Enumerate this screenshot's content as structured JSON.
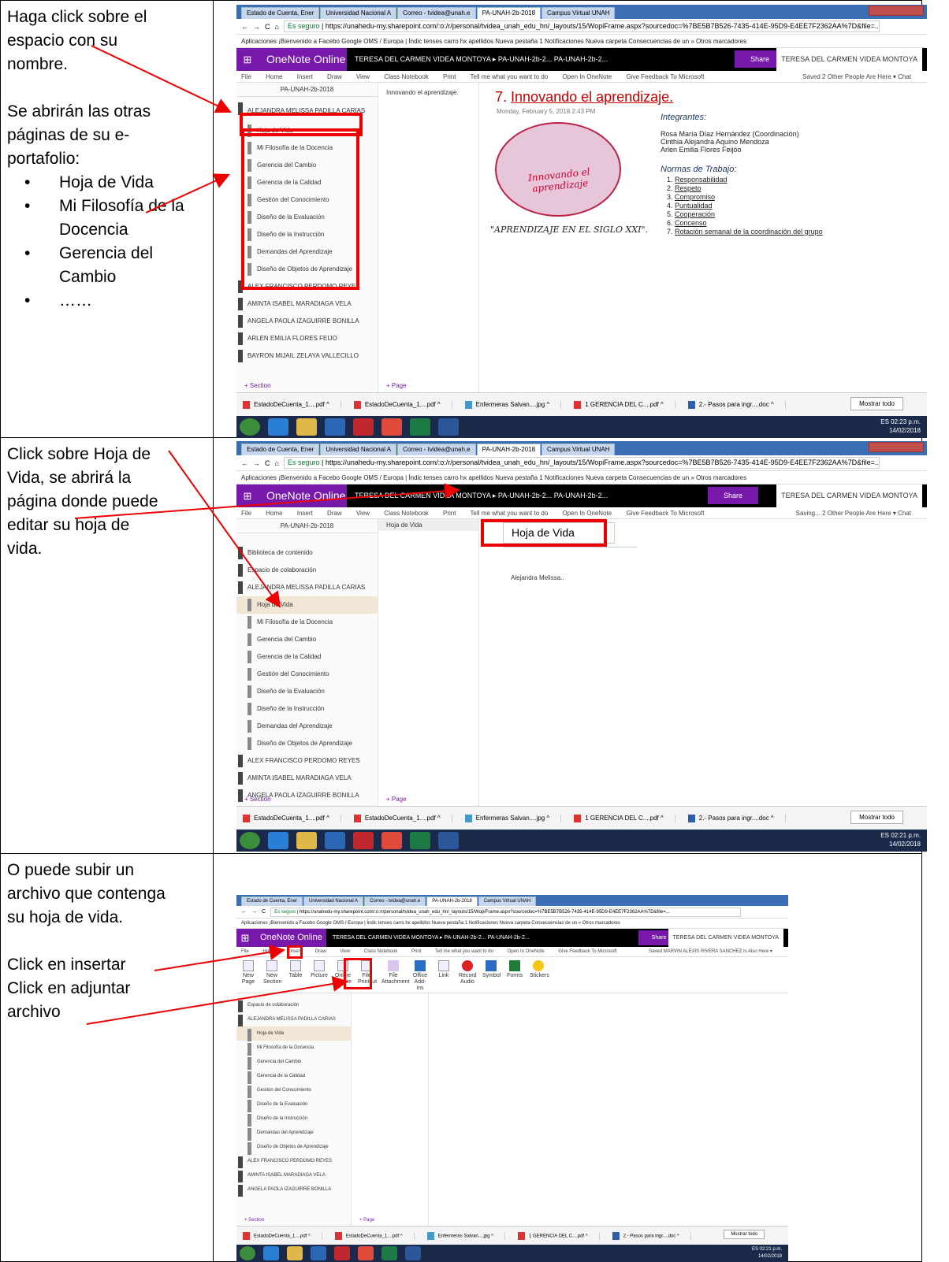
{
  "rows": [
    {
      "instruction_lines": [
        "Haga click sobre el",
        "espacio con su",
        "nombre."
      ],
      "instruction_lines2": [
        "Se abrirán las otras",
        "páginas de su e-",
        "portafolio:"
      ],
      "bullets": [
        "Hoja de Vida",
        "Mi Filosofía de la Docencia",
        "Gerencia del Cambio",
        "……"
      ]
    },
    {
      "instruction_lines": [
        "Click sobre Hoja de",
        "Vida, se abrirá la",
        "página donde puede",
        "editar su hoja de",
        "vida."
      ]
    },
    {
      "instruction_lines": [
        "O puede subir un",
        "archivo que contenga",
        "su hoja de vida."
      ],
      "instruction_lines2": [
        "Click en insertar",
        "Click en adjuntar",
        "archivo"
      ]
    }
  ],
  "browser": {
    "tabs": [
      "Estado de Cuenta, Ener",
      "Universidad Nacional A",
      "Correo - tvidea@unah.e",
      "PA-UNAH-2b-2018",
      "Campus Virtual UNAH"
    ],
    "secure": "Es seguro",
    "url": "https://unahedu-my.sharepoint.com/:o:/r/personal/tvidea_unah_edu_hn/_layouts/15/WopiFrame.aspx?sourcedoc=%7BE5B7B526-7435-414E-95D9-E4EE7F2362AA%7D&file=...",
    "bookmarks": "Aplicaciones   ¡Bienvenido a Facebo   Google   OMS / Europa | Índic   tenses   carro   hx apellidos   Nueva pestaña   1 Notificaciones   Nueva carpeta   Consecuencias de un   »   Otros marcadores"
  },
  "onenote": {
    "waffle": "⊞",
    "brand": "OneNote Online",
    "breadcrumb": "TERESA DEL CARMEN VIDEA MONTOYA  ▸  PA-UNAH-2b-2...          PA-UNAH-2b-2...",
    "share": "Share",
    "user": "TERESA DEL CARMEN VIDEA MONTOYA",
    "menu": [
      "File",
      "Home",
      "Insert",
      "Draw",
      "View",
      "Class Notebook",
      "Print",
      "Tell me what you want to do",
      "Open In OneNote",
      "Give Feedback To Microsoft"
    ],
    "status1": "Saved   2 Other People Are Here ▾   Chat",
    "status2": "Saving...   2 Other People Are Here ▾   Chat",
    "status3": "Saved   MARVIN ALEXIS RIVERA SANCHEZ Is Also Here ▾",
    "notebook": "PA-UNAH-2b-2018",
    "section_open": "ALEJANDRA MELISSA PADILLA CARIAS",
    "pages": [
      "Hoja de Vida",
      "Mi Filosofía de la Docencia",
      "Gerencia del Cambio",
      "Gerencia de la Calidad",
      "Gestión del Conocimiento",
      "Diseño de la Evaluación",
      "Diseño de la Instrucción",
      "Demandas del Aprendizaje",
      "Diseño de Objetos de Aprendizaje"
    ],
    "other_sections": [
      "ALEX FRANCISCO PERDOMO REYES",
      "AMINTA ISABEL MARADIAGA VELA",
      "ANGELA PAOLA IZAGUIRRE BONILLA",
      "ARLEN EMILIA FLORES FEIJO",
      "BAYRON MIJAIL ZELAYA VALLECILLO"
    ],
    "extra_sections": [
      "Biblioteca de contenido",
      "Espacio de colaboración"
    ],
    "add_section": "+ Section",
    "add_page": "+ Page",
    "page_list_item": "Innovando el aprendizaje.",
    "page2_list_item": "Hoja de Vida"
  },
  "page1": {
    "title_num": "7.",
    "title": "Innovando el aprendizaje.",
    "date": "Monday, February 5, 2018   2:43 PM",
    "logo_text": "Innovando el aprendizaje",
    "quote": "\"APRENDIZAJE EN EL SIGLO  XXI\".",
    "integrantes_h": "Integrantes:",
    "integrantes": [
      "Rosa María Díaz Hernández (Coordinación)",
      "Cinthia Alejandra Aquino Mendoza",
      "Arlen Emilia Flores Feijóo"
    ],
    "normas_h": "Normas de Trabajo:",
    "normas": [
      "Responsabilidad",
      "Respeto",
      "Compromiso",
      "Puntualidad",
      "Cooperación",
      "Concenso",
      "Rotación semanal de la coordinación del grupo"
    ]
  },
  "page2": {
    "title": "Hoja de Vida",
    "text": "Alejandra Melissa.."
  },
  "ribbon": [
    "New Page",
    "New Section",
    "Table",
    "Picture",
    "Online Picture",
    "File Printout",
    "File Attachment",
    "Office Add-ins",
    "Link",
    "Record Audio",
    "Symbol",
    "Forms",
    "Stickers"
  ],
  "downloads": [
    "EstadoDeCuenta_1....pdf",
    "EstadoDeCuenta_1....pdf",
    "Enfermeras Salvan....jpg",
    "1 GERENCIA DEL C....pdf",
    "2.- Pasos para ingr....doc"
  ],
  "mostrar": "Mostrar todo",
  "clock1": [
    "02:23 p.m.",
    "14/02/2018"
  ],
  "clock2": [
    "02:21 p.m.",
    "14/02/2018"
  ],
  "clock3": [
    "02:21 p.m.",
    "14/02/2018"
  ],
  "lang": "ES"
}
